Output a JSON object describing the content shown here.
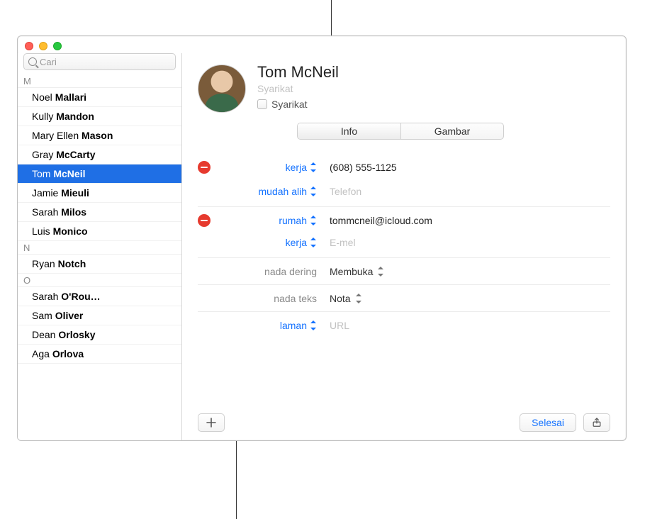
{
  "search": {
    "placeholder": "Cari"
  },
  "sidebar": {
    "groups": [
      {
        "letter": "M",
        "items": [
          {
            "first": "Noel",
            "last": "Mallari"
          },
          {
            "first": "Kully",
            "last": "Mandon"
          },
          {
            "first": "Mary Ellen",
            "last": "Mason"
          },
          {
            "first": "Gray",
            "last": "McCarty"
          },
          {
            "first": "Tom",
            "last": "McNeil",
            "selected": true
          },
          {
            "first": "Jamie",
            "last": "Mieuli"
          },
          {
            "first": "Sarah",
            "last": "Milos"
          },
          {
            "first": "Luis",
            "last": "Monico"
          }
        ]
      },
      {
        "letter": "N",
        "items": [
          {
            "first": "Ryan",
            "last": "Notch"
          }
        ]
      },
      {
        "letter": "O",
        "items": [
          {
            "first": "Sarah",
            "last": "O'Rou…"
          },
          {
            "first": "Sam",
            "last": "Oliver"
          },
          {
            "first": "Dean",
            "last": "Orlosky"
          },
          {
            "first": "Aga",
            "last": "Orlova"
          }
        ]
      }
    ]
  },
  "card": {
    "name": "Tom McNeil",
    "company_placeholder": "Syarikat",
    "company_checkbox_label": "Syarikat",
    "tabs": {
      "info": "Info",
      "gambar": "Gambar"
    },
    "phone_work_label": "kerja",
    "phone_work_value": "(608) 555-1125",
    "phone_mobile_label": "mudah alih",
    "phone_placeholder": "Telefon",
    "email_home_label": "rumah",
    "email_home_value": "tommcneil@icloud.com",
    "email_work_label": "kerja",
    "email_placeholder": "E-mel",
    "ringtone_label": "nada dering",
    "ringtone_value": "Membuka",
    "texttone_label": "nada teks",
    "texttone_value": "Nota",
    "url_label": "laman",
    "url_placeholder": "URL"
  },
  "footer": {
    "done": "Selesai"
  }
}
